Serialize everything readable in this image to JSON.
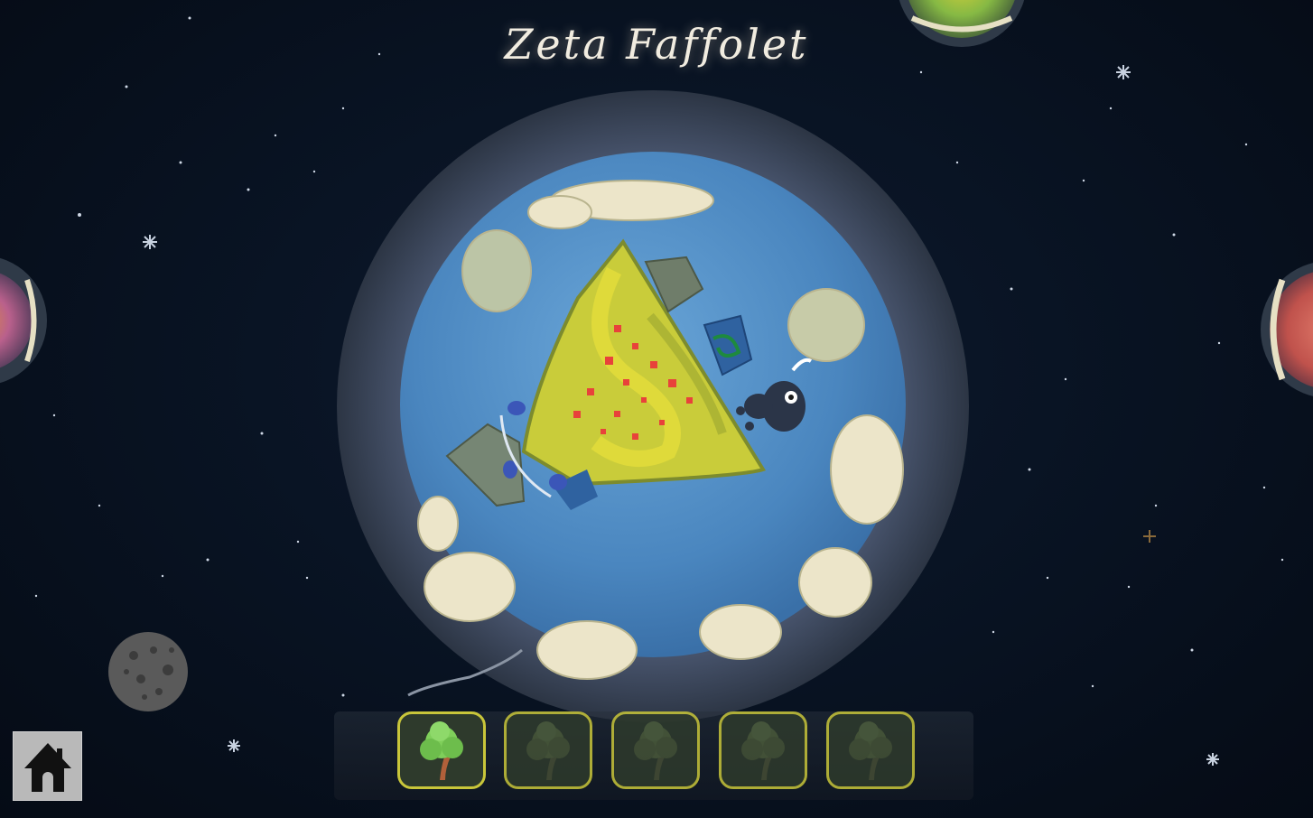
{
  "planet": {
    "name": "Zeta Faffolet"
  },
  "toolbar": {
    "slots": [
      {
        "icon": "tree-icon",
        "state": "active"
      },
      {
        "icon": "tree-icon",
        "state": "locked"
      },
      {
        "icon": "tree-icon",
        "state": "locked"
      },
      {
        "icon": "tree-icon",
        "state": "locked"
      },
      {
        "icon": "tree-icon",
        "state": "locked"
      }
    ]
  },
  "home_button": {
    "icon": "home-icon"
  },
  "colors": {
    "ocean": "#4f8cc4",
    "atmosphere": "#3a4656",
    "land": "#c9cc3a",
    "cloud": "#e9e2c6",
    "slot_border": "#c9c63a"
  }
}
